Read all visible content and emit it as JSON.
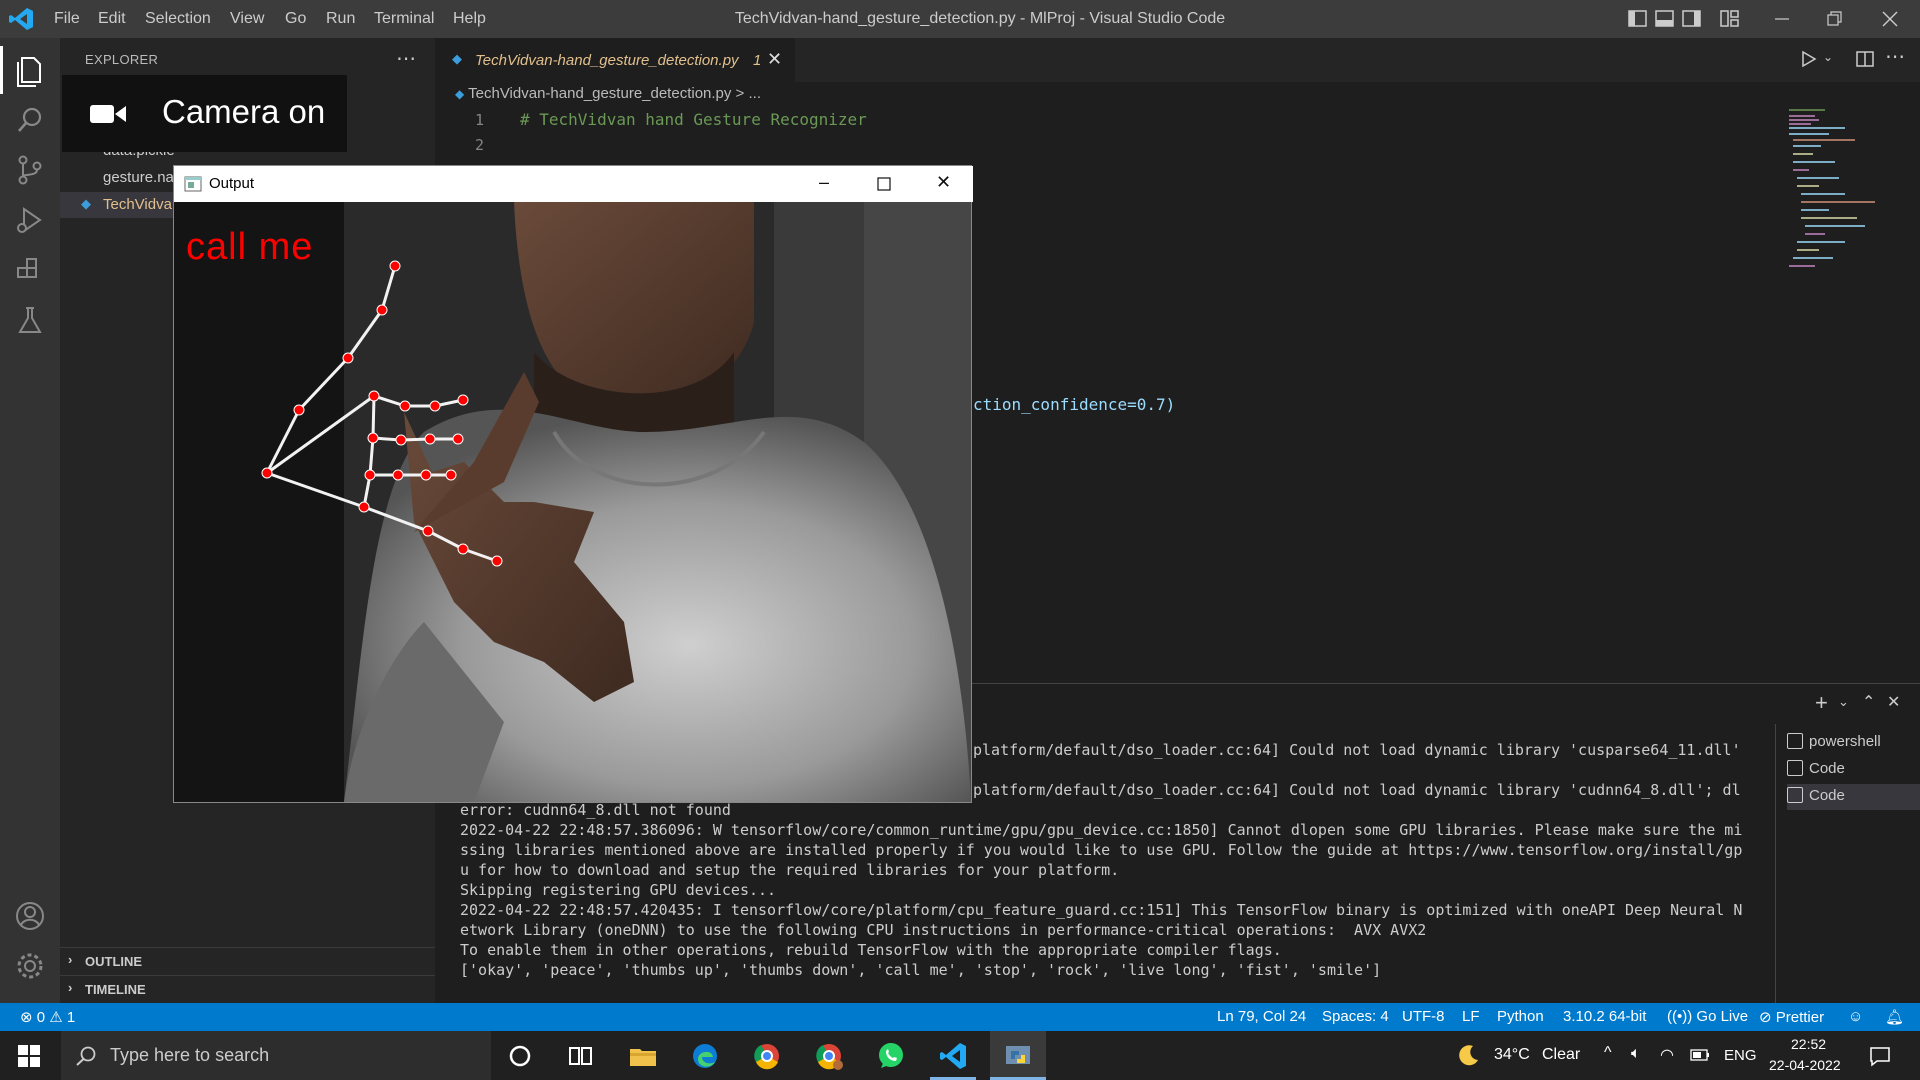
{
  "app": {
    "menu": [
      "File",
      "Edit",
      "Selection",
      "View",
      "Go",
      "Run",
      "Terminal",
      "Help"
    ],
    "window_title": "TechVidvan-hand_gesture_detection.py - MlProj - Visual Studio Code"
  },
  "explorer": {
    "title": "EXPLORER",
    "files": [
      "data.pickle",
      "gesture.na",
      "TechVidva"
    ],
    "sections": [
      "OUTLINE",
      "TIMELINE"
    ]
  },
  "camera_overlay": {
    "label": "Camera on"
  },
  "editor": {
    "tab_label": "TechVidvan-hand_gesture_detection.py",
    "tab_badge": "1",
    "breadcrumb": "TechVidvan-hand_gesture_detection.py > ...",
    "lines": [
      {
        "num": "1",
        "text": "# TechVidvan hand Gesture Recognizer"
      },
      {
        "num": "2",
        "text": ""
      }
    ],
    "visible_code_fragment": "ction_confidence=0.7)"
  },
  "output_window": {
    "title": "Output",
    "gesture_label": "call  me"
  },
  "terminal": {
    "lines": [
      "platform/default/dso_loader.cc:64] Could not load dynamic library 'cusparse64_11.dll'",
      "platform/default/dso_loader.cc:64] Could not load dynamic library 'cudnn64_8.dll'; dl",
      "error: cudnn64_8.dll not found",
      "2022-04-22 22:48:57.386096: W tensorflow/core/common_runtime/gpu/gpu_device.cc:1850] Cannot dlopen some GPU libraries. Please make sure the mi",
      "ssing libraries mentioned above are installed properly if you would like to use GPU. Follow the guide at https://www.tensorflow.org/install/gp",
      "u for how to download and setup the required libraries for your platform.",
      "Skipping registering GPU devices...",
      "2022-04-22 22:48:57.420435: I tensorflow/core/platform/cpu_feature_guard.cc:151] This TensorFlow binary is optimized with oneAPI Deep Neural N",
      "etwork Library (oneDNN) to use the following CPU instructions in performance-critical operations:  AVX AVX2",
      "To enable them in other operations, rebuild TensorFlow with the appropriate compiler flags.",
      "['okay', 'peace', 'thumbs up', 'thumbs down', 'call me', 'stop', 'rock', 'live long', 'fist', 'smile']"
    ],
    "instances": [
      "powershell",
      "Code",
      "Code"
    ]
  },
  "statusbar": {
    "errors": "0",
    "warnings": "1",
    "position": "Ln 79, Col 24",
    "spaces": "Spaces: 4",
    "encoding": "UTF-8",
    "eol": "LF",
    "language": "Python",
    "interpreter": "3.10.2 64-bit",
    "golive": "Go Live",
    "prettier": "Prettier"
  },
  "taskbar": {
    "search_placeholder": "Type here to search",
    "weather_temp": "34°C",
    "weather_text": "Clear",
    "lang": "ENG",
    "time": "22:52",
    "date": "22-04-2022"
  },
  "colors": {
    "accent_blue": "#007acc",
    "landmark_red": "#ff0000",
    "label_red": "#ff0000"
  }
}
